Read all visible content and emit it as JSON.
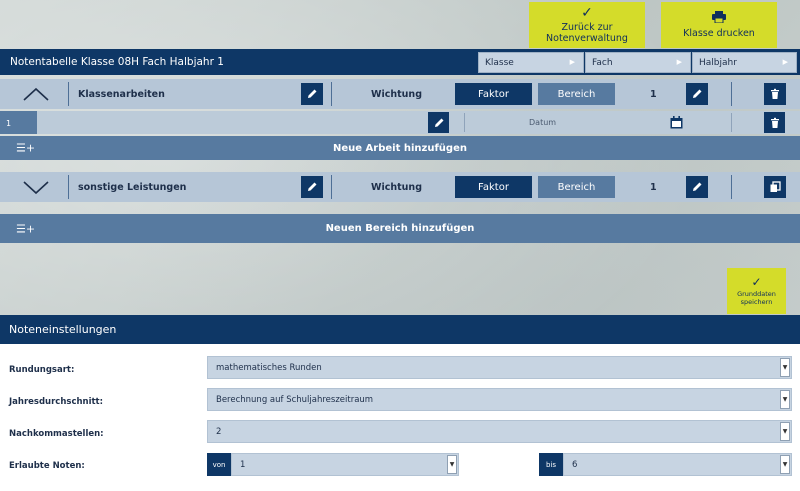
{
  "actions": {
    "back_label_line1": "Zurück zur",
    "back_label_line2": "Notenverwaltung",
    "print_label": "Klasse drucken"
  },
  "header": {
    "title": "Notentabelle Klasse 08H Fach Halbjahr 1",
    "selects": [
      {
        "label": "Klasse"
      },
      {
        "label": "Fach"
      },
      {
        "label": "Halbjahr"
      }
    ]
  },
  "sections": [
    {
      "name": "Klassenarbeiten",
      "weight_label": "Wichtung",
      "option_active": "Faktor",
      "option_inactive": "Bereich",
      "value": "1",
      "exams": [
        {
          "number": "1",
          "date_placeholder": "Datum"
        }
      ],
      "add_label": "Neue Arbeit hinzufügen"
    },
    {
      "name": "sonstige Leistungen",
      "weight_label": "Wichtung",
      "option_active": "Faktor",
      "option_inactive": "Bereich",
      "value": "1"
    }
  ],
  "add_section_label": "Neuen Bereich hinzufügen",
  "save": {
    "line1": "Grunddaten",
    "line2": "speichern"
  },
  "settings": {
    "title": "Noteneinstellungen",
    "rounding_label": "Rundungsart:",
    "rounding_value": "mathematisches Runden",
    "average_label": "Jahresdurchschnitt:",
    "average_value": "Berechnung auf Schuljahreszeitraum",
    "decimals_label": "Nachkommastellen:",
    "decimals_value": "2",
    "grades_label": "Erlaubte Noten:",
    "from_label": "von",
    "from_value": "1",
    "to_label": "bis",
    "to_value": "6"
  },
  "colors": {
    "navy": "#0e3766",
    "accent": "#d4dc2a",
    "row_light": "#b6c6d7",
    "row_dark": "#577aa0"
  }
}
